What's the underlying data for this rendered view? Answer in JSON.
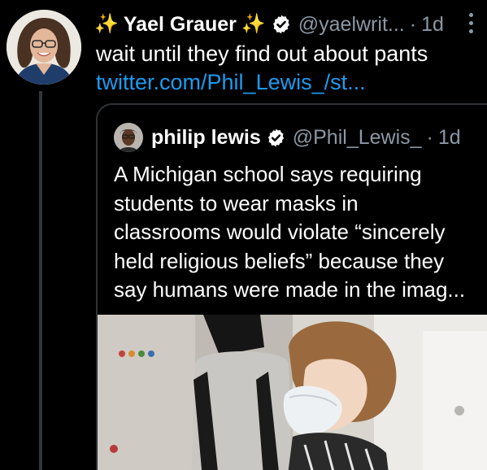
{
  "tweet": {
    "display_name": "Yael Grauer",
    "name_emoji_left": "✨",
    "name_emoji_right": "✨",
    "handle": "@yaelwrit...",
    "separator": "·",
    "time": "1d",
    "text": "wait until they find out about pants",
    "link": "twitter.com/Phil_Lewis_/st..."
  },
  "quoted": {
    "display_name": "philip lewis",
    "handle": "@Phil_Lewis_",
    "separator": "·",
    "time": "1d",
    "text_lines": [
      "A Michigan school says requiring",
      "students to wear masks in",
      "classrooms would violate “sincerely",
      "held religious beliefs” because they",
      "say humans were made in the imag..."
    ]
  },
  "icons": {
    "verified": "verified-badge-icon",
    "more": "more-options-icon"
  },
  "colors": {
    "background": "#000000",
    "text": "#ffffff",
    "muted": "#8b98a5",
    "link": "#1d9bf0",
    "border": "#2f3336",
    "sparkle": "#f4c542"
  }
}
